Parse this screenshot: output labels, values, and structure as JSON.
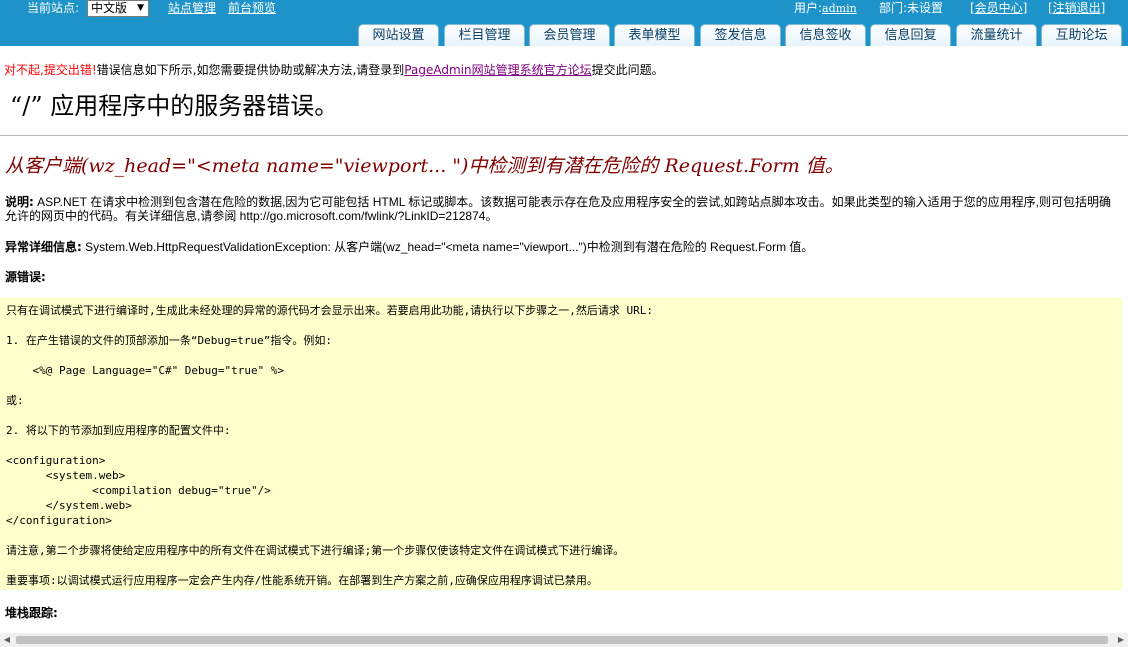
{
  "topbar": {
    "site_label": "当前站点:",
    "site_select_value": "中文版",
    "site_select_arrow": "▼",
    "link_site_manage": "站点管理",
    "link_preview": "前台预览",
    "user_label": "用户:",
    "user_name": "admin",
    "dept": "部门:未设置",
    "link_member_center": "[会员中心]",
    "link_logout": "[注销退出]"
  },
  "tabs": [
    "网站设置",
    "栏目管理",
    "会员管理",
    "表单模型",
    "签发信息",
    "信息签收",
    "信息回复",
    "流量统计",
    "互助论坛"
  ],
  "error_notice": {
    "sorry": "对不起,提交出错!",
    "text1": "错误信息如下所示,如您需要提供协助或解决方法,请登录到",
    "forum_link": "PageAdmin网站管理系统官方论坛",
    "text2": "提交此问题。"
  },
  "heading": "“/” 应用程序中的服务器错误。",
  "subheading": "从客户端(wz_head=\"<meta name=\"viewport... \")中检测到有潜在危险的 Request.Form 值。",
  "description": {
    "label": "说明:",
    "text": "ASP.NET 在请求中检测到包含潜在危险的数据,因为它可能包括 HTML 标记或脚本。该数据可能表示存在危及应用程序安全的尝试,如跨站点脚本攻击。如果此类型的输入适用于您的应用程序,则可包括明确允许的网页中的代码。有关详细信息,请参阅 http://go.microsoft.com/fwlink/?LinkID=212874。"
  },
  "exception": {
    "label": "异常详细信息:",
    "text": "System.Web.HttpRequestValidationException: 从客户端(wz_head=\"<meta name=\"viewport...\")中检测到有潜在危险的 Request.Form 值。"
  },
  "source_error_label": "源错误:",
  "code_lines": [
    "只有在调试模式下进行编译时,生成此未经处理的异常的源代码才会显示出来。若要启用此功能,请执行以下步骤之一,然后请求 URL:",
    "1. 在产生错误的文件的顶部添加一条“Debug=true”指令。例如:",
    "    <%@ Page Language=\"C#\" Debug=\"true\" %>",
    "或:",
    "2. 将以下的节添加到应用程序的配置文件中:",
    "<configuration>",
    "      <system.web>",
    "             <compilation debug=\"true\"/>",
    "      </system.web>",
    "</configuration>",
    "请注意,第二个步骤将使给定应用程序中的所有文件在调试模式下进行编译;第一个步骤仅使该特定文件在调试模式下进行编译。",
    "重要事项:以调试模式运行应用程序一定会产生内存/性能系统开销。在部署到生产方案之前,应确保应用程序调试已禁用。"
  ],
  "stack_trace_label": "堆栈跟踪:",
  "scrollbar": {
    "left_arrow": "◀",
    "right_arrow": "▶"
  },
  "colors": {
    "topbar": "#1d93c9",
    "code_bg": "#ffffcc",
    "subheading": "#800000",
    "notice_red": "#ff0000"
  }
}
